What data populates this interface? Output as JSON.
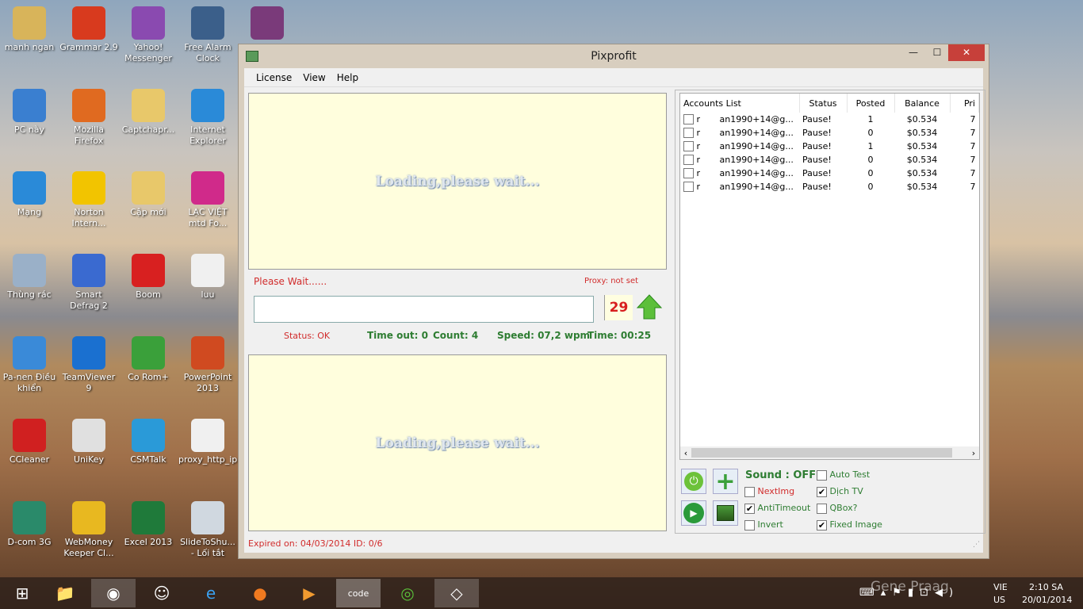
{
  "desktop": {
    "icons": [
      {
        "label": "manh ngan",
        "color": "#d8b45a"
      },
      {
        "label": "Grammar 2.9",
        "color": "#d83a1e"
      },
      {
        "label": "Yahoo! Messenger",
        "color": "#8a4ab0"
      },
      {
        "label": "Free Alarm Clock",
        "color": "#3b5f8a"
      },
      {
        "label": "",
        "color": "#7a3a7a"
      },
      {
        "label": "PC này",
        "color": "#3a7fd0"
      },
      {
        "label": "Mozilla Firefox",
        "color": "#e06a20"
      },
      {
        "label": "Captchapr...",
        "color": "#e8c86a"
      },
      {
        "label": "Internet Explorer",
        "color": "#2a8ad8"
      },
      {
        "label": "Mạng",
        "color": "#2a8ad8"
      },
      {
        "label": "Norton Intern...",
        "color": "#f2c400"
      },
      {
        "label": "Cập mới",
        "color": "#e8c86a"
      },
      {
        "label": "LẠC VIỆT mtd Fo...",
        "color": "#d02a8a"
      },
      {
        "label": "Thùng rác",
        "color": "#9ab0c8"
      },
      {
        "label": "Smart Defrag 2",
        "color": "#3a6ad0"
      },
      {
        "label": "Boom",
        "color": "#d82020"
      },
      {
        "label": "luu",
        "color": "#f0f0f0"
      },
      {
        "label": "Pa-nen Điều khiển",
        "color": "#3a8ad8"
      },
      {
        "label": "TeamViewer 9",
        "color": "#1a70d0"
      },
      {
        "label": "Co Rom+",
        "color": "#3aa03a"
      },
      {
        "label": "PowerPoint 2013",
        "color": "#d04a20"
      },
      {
        "label": "CCleaner",
        "color": "#d02020"
      },
      {
        "label": "UniKey",
        "color": "#e0e0e0"
      },
      {
        "label": "CSMTalk",
        "color": "#2a9ad8"
      },
      {
        "label": "proxy_http_ip",
        "color": "#f0f0f0"
      },
      {
        "label": "D-com 3G",
        "color": "#2a8a6a"
      },
      {
        "label": "WebMoney Keeper Cl...",
        "color": "#e8b820"
      },
      {
        "label": "Excel 2013",
        "color": "#1f7a3a"
      },
      {
        "label": "SlideToShu... - Lối tắt",
        "color": "#d0d8e0"
      }
    ]
  },
  "window": {
    "title": "Pixprofit",
    "minimize": "—",
    "maximize": "☐",
    "close": "✕",
    "menu": [
      "License",
      "View",
      "Help"
    ],
    "captcha_top": "Loading,please wait...",
    "captcha_bottom": "Loading,please wait...",
    "please_wait": "Please Wait......",
    "proxy": "Proxy: not set",
    "answer_value": "",
    "countdown": "29",
    "status": "Status: OK",
    "timeout": "Time out: 0",
    "count": "Count: 4",
    "speed": "Speed: 07,2 wpm",
    "time": "Time: 00:25",
    "accounts": {
      "columns": [
        "Accounts List",
        "Status",
        "Posted",
        "Balance",
        "Pri"
      ],
      "rows": [
        {
          "account": "r       an1990+14@g...",
          "status": "Pause!",
          "posted": "1",
          "balance": "$0.534",
          "pri": "7"
        },
        {
          "account": "r       an1990+14@g...",
          "status": "Pause!",
          "posted": "0",
          "balance": "$0.534",
          "pri": "7"
        },
        {
          "account": "r       an1990+14@g...",
          "status": "Pause!",
          "posted": "1",
          "balance": "$0.534",
          "pri": "7"
        },
        {
          "account": "r       an1990+14@g...",
          "status": "Pause!",
          "posted": "0",
          "balance": "$0.534",
          "pri": "7"
        },
        {
          "account": "r       an1990+14@g...",
          "status": "Pause!",
          "posted": "0",
          "balance": "$0.534",
          "pri": "7"
        },
        {
          "account": "r       an1990+14@g...",
          "status": "Pause!",
          "posted": "0",
          "balance": "$0.534",
          "pri": "7"
        }
      ]
    },
    "sound": "Sound : OFF",
    "options": [
      {
        "label": "NextImg",
        "checked": false
      },
      {
        "label": "AntiTimeout",
        "checked": true
      },
      {
        "label": "Invert",
        "checked": false
      },
      {
        "label": "Auto Test",
        "checked": false
      },
      {
        "label": "Dịch TV",
        "checked": true
      },
      {
        "label": "QBox?",
        "checked": false
      },
      {
        "label": "Fixed Image",
        "checked": true
      }
    ],
    "expired": "Expired on: 04/03/2014   ID: 0/6"
  },
  "taskbar": {
    "lang1": "VIE",
    "lang2": "US",
    "time": "2:10 SA",
    "date": "20/01/2014",
    "watermark": "Gene Praag"
  }
}
